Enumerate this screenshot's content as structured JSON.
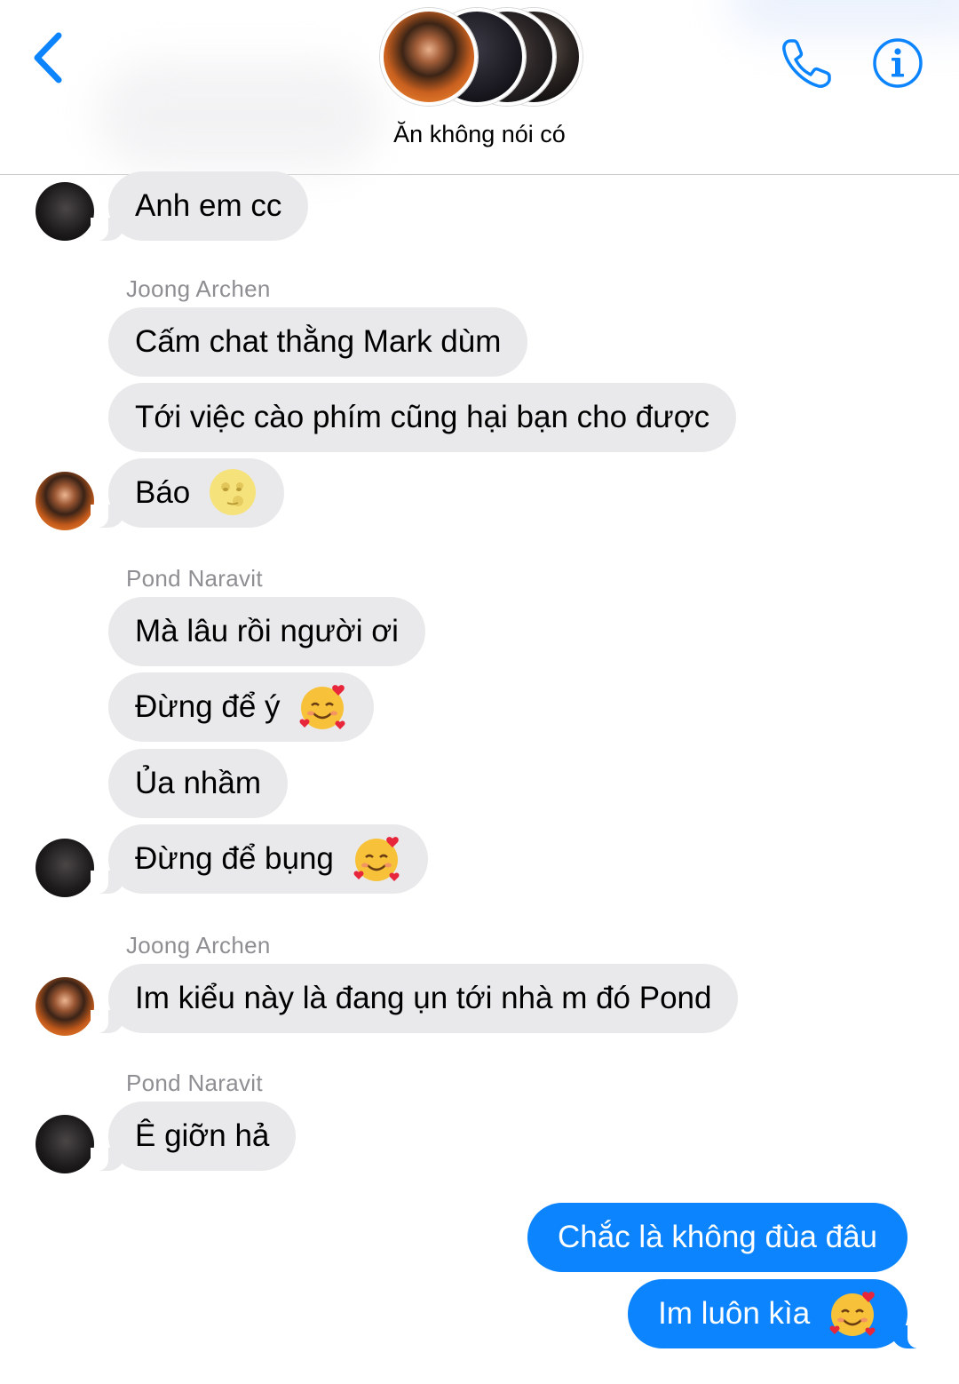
{
  "header": {
    "group_name": "Ăn không nói có"
  },
  "colors": {
    "accent": "#0b84fe",
    "incoming_bubble": "#e9e9eb",
    "sender_name": "#8e8e93"
  },
  "icons": {
    "back": "chevron-left-icon",
    "call": "phone-icon",
    "info": "info-icon"
  },
  "messages": {
    "m1": "Anh em cc",
    "sender_joong_1": "Joong Archen",
    "m2": "Cấm chat thằng Mark dùm",
    "m3": "Tới việc cào phím cũng hại bạn cho được",
    "m4": "Báo",
    "sender_pond_1": "Pond Naravit",
    "m5": "Mà lâu rồi người ơi",
    "m6": "Đừng để ý",
    "m7": "Ủa nhầm",
    "m8": "Đừng để bụng",
    "sender_joong_2": "Joong Archen",
    "m9": "Im kiểu này là đang ụn tới nhà m đó Pond",
    "sender_pond_2": "Pond Naravit",
    "m10": "Ê giỡn hả",
    "m11": "Chắc là không đùa đâu",
    "m12": "Im luôn kìa"
  }
}
